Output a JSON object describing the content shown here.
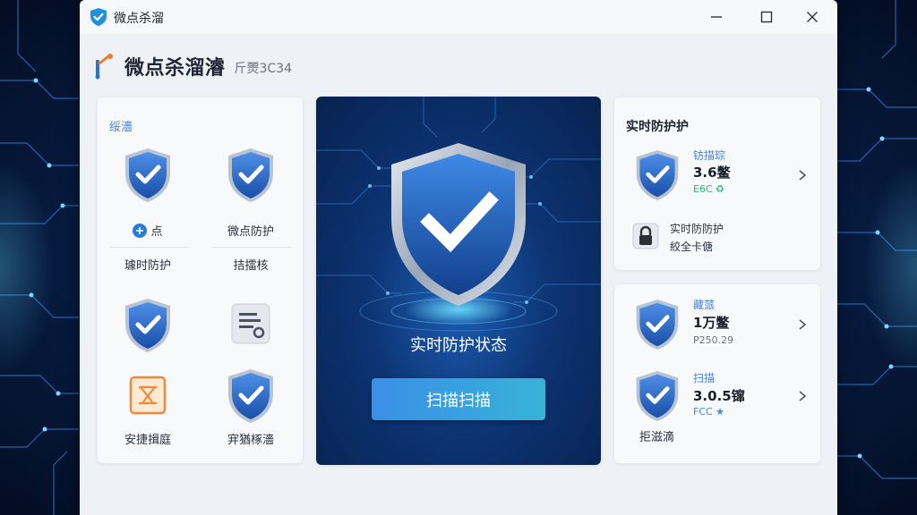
{
  "window": {
    "title": "微点杀溜",
    "controls": {
      "minimize": "minimize",
      "maximize": "maximize",
      "close": "close"
    }
  },
  "header": {
    "brand": "微点杀溜濬",
    "version": "⽄燛3C34"
  },
  "left_panel": {
    "section_label": "绥濇",
    "tiles": [
      {
        "label": "点",
        "sub_label": "璩时防护",
        "icon": "shield-check-icon"
      },
      {
        "label": "微点防护",
        "sub_label": "拮擂核",
        "icon": "shield-check-icon"
      },
      {
        "label": "",
        "sub_label": "",
        "icon": "shield-check-icon"
      },
      {
        "label": "",
        "sub_label": "",
        "icon": "document-settings-icon"
      },
      {
        "label": "",
        "sub_label": "安捷揖庭",
        "icon": "orange-window-icon"
      },
      {
        "label": "",
        "sub_label": "宑猶椓濇",
        "icon": "shield-check-icon"
      }
    ]
  },
  "center_panel": {
    "status": "实时防护状态",
    "scan_button": "扫描扫描"
  },
  "right_top": {
    "title": "实时防护护",
    "row1": {
      "name": "钫描琮",
      "value": "3.6鳖",
      "sub": "E6C ♻"
    },
    "lock_row": {
      "line1": "实时防防护",
      "line2": "絞全卡傏"
    }
  },
  "right_bottom": {
    "row1": {
      "name": "藏蒎",
      "value": "1万鳖",
      "sub": "P250.29"
    },
    "row2": {
      "name": "扫描",
      "value": "3.0.5镩",
      "sub": "FCC ★"
    },
    "footer": "拒滋滴"
  },
  "colors": {
    "accent_blue": "#4a7fd6",
    "scan_button_start": "#3a8ee6",
    "scan_button_end": "#37b3d8",
    "status_green": "#2bb574",
    "center_bg": "#0d3474"
  }
}
